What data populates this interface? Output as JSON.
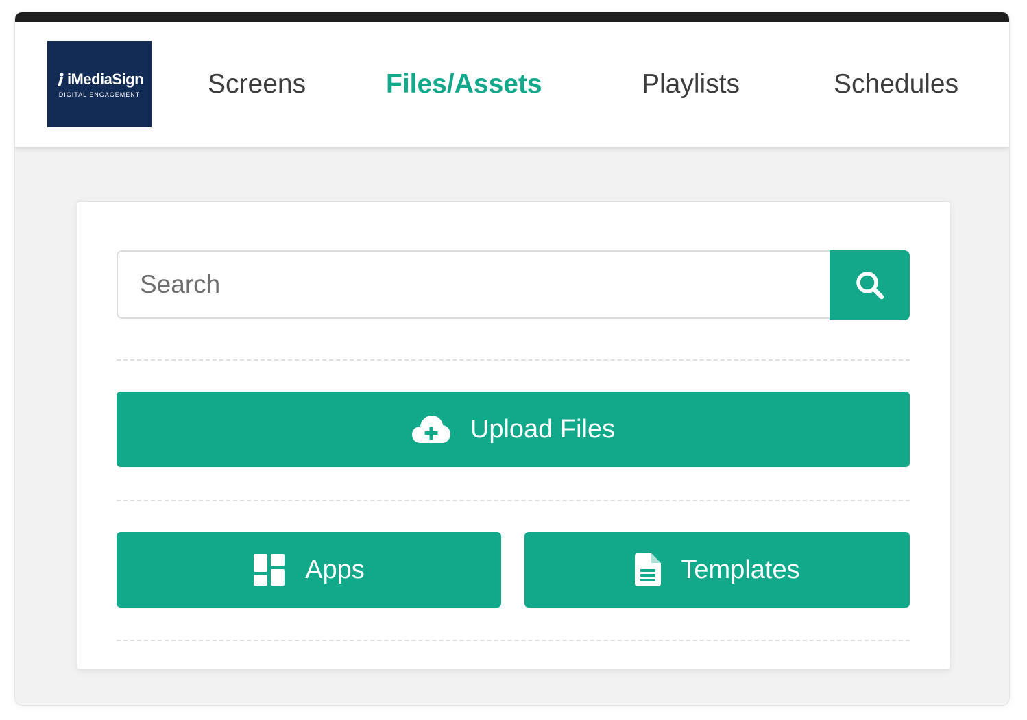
{
  "brand": {
    "name": "iMediaSign",
    "tagline": "DIGITAL ENGAGEMENT"
  },
  "nav": {
    "items": [
      {
        "label": "Screens"
      },
      {
        "label": "Files/Assets",
        "active": true
      },
      {
        "label": "Playlists"
      },
      {
        "label": "Schedules"
      }
    ]
  },
  "search": {
    "placeholder": "Search",
    "value": ""
  },
  "actions": {
    "upload_label": "Upload Files",
    "apps_label": "Apps",
    "templates_label": "Templates"
  },
  "icons": {
    "search": "search-icon",
    "upload": "cloud-upload-icon",
    "apps": "grid-icon",
    "templates": "document-icon"
  },
  "colors": {
    "accent": "#13a88a",
    "logo_bg": "#132c55",
    "nav_text": "#3d3d3d",
    "topbar": "#1f1f1f"
  }
}
